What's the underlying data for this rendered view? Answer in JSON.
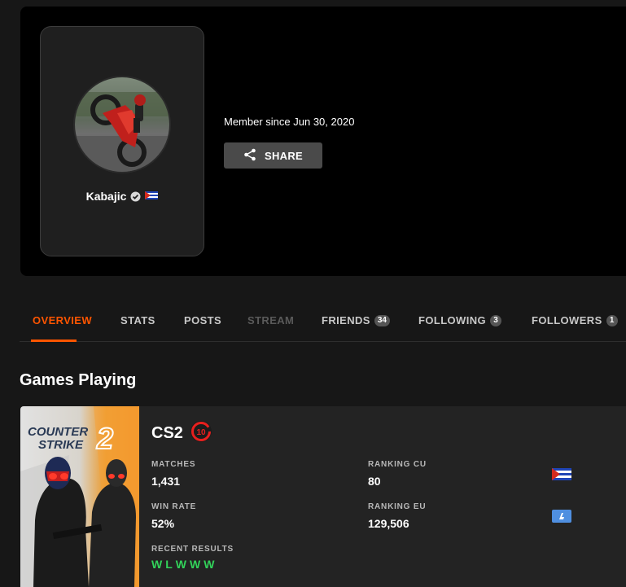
{
  "profile": {
    "username": "Kabajic",
    "member_since": "Member since Jun 30, 2020",
    "share_label": "SHARE",
    "country_flag": "cuba-flag-icon",
    "verified_icon": "verified-badge-icon"
  },
  "tabs": [
    {
      "label": "OVERVIEW",
      "state": "active"
    },
    {
      "label": "STATS",
      "state": "normal"
    },
    {
      "label": "POSTS",
      "state": "normal"
    },
    {
      "label": "STREAM",
      "state": "disabled"
    },
    {
      "label": "FRIENDS",
      "count": "34",
      "state": "normal"
    },
    {
      "label": "FOLLOWING",
      "count": "3",
      "state": "normal"
    },
    {
      "label": "FOLLOWERS",
      "count": "1",
      "state": "normal"
    }
  ],
  "games_section": {
    "title": "Games Playing",
    "games": [
      {
        "cover_text_line1": "COUNTER",
        "cover_text_line2": "STRIKE",
        "cover_number": "2",
        "name": "CS2",
        "level": "10",
        "matches_label": "MATCHES",
        "matches_value": "1,431",
        "win_rate_label": "WIN RATE",
        "win_rate_value": "52%",
        "ranking_country_label": "RANKING CU",
        "ranking_country_value": "80",
        "ranking_region_label": "RANKING EU",
        "ranking_region_value": "129,506",
        "recent_results_label": "RECENT RESULTS",
        "recent_results": [
          "W",
          "L",
          "W",
          "W",
          "W"
        ]
      }
    ]
  },
  "colors": {
    "accent": "#ff5500",
    "win": "#32d35a",
    "level_badge": "#e8201e"
  }
}
